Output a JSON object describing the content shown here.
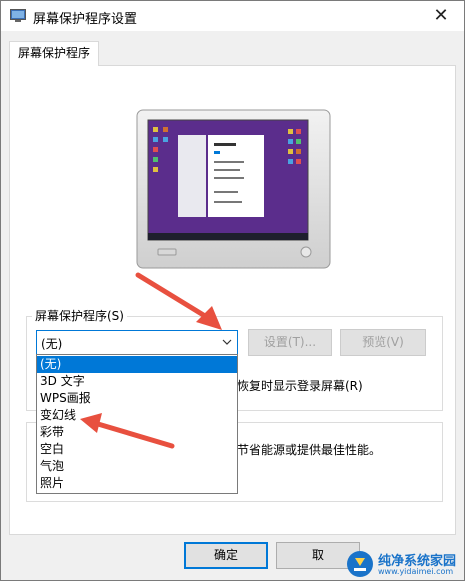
{
  "window": {
    "title": "屏幕保护程序设置",
    "close_glyph": "✕"
  },
  "tabs": [
    {
      "label": "屏幕保护程序"
    }
  ],
  "screensaver": {
    "group_label": "屏幕保护程序(S)",
    "selected_value": "(无)",
    "options": [
      "(无)",
      "3D 文字",
      "WPS画报",
      "变幻线",
      "彩带",
      "空白",
      "气泡",
      "照片"
    ],
    "settings_label": "设置(T)...",
    "preview_label": "预览(V)",
    "resume_text": "恢复时显示登录屏幕(R)"
  },
  "power": {
    "text": "节省能源或提供最佳性能。"
  },
  "footer": {
    "ok_label": "确定",
    "cancel_label": "取"
  },
  "watermark": {
    "name": "纯净系统家园",
    "url": "www.yidaimei.com"
  },
  "colors": {
    "accent": "#0078d7",
    "annotation_arrow": "#e8503f",
    "monitor_screen": "#5b2d8c"
  }
}
